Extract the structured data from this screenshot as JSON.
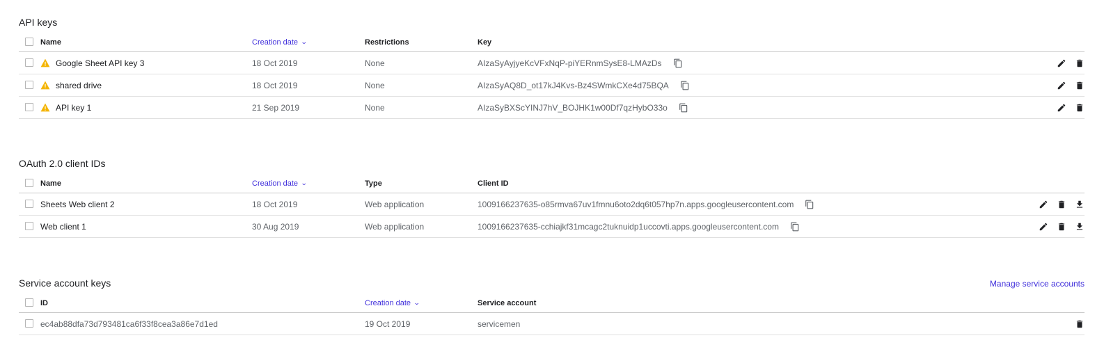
{
  "api_keys": {
    "title": "API keys",
    "columns": {
      "name": "Name",
      "creation_date": "Creation date",
      "restrictions": "Restrictions",
      "key": "Key"
    },
    "rows": [
      {
        "name": "Google Sheet API key 3",
        "date": "18 Oct 2019",
        "restrictions": "None",
        "key": "AIzaSyAyjyeKcVFxNqP-piYERnmSysE8-LMAzDs"
      },
      {
        "name": "shared drive",
        "date": "18 Oct 2019",
        "restrictions": "None",
        "key": "AIzaSyAQ8D_ot17kJ4Kvs-Bz4SWmkCXe4d75BQA"
      },
      {
        "name": "API key 1",
        "date": "21 Sep 2019",
        "restrictions": "None",
        "key": "AIzaSyBXScYINJ7hV_BOJHK1w00Df7qzHybO33o"
      }
    ]
  },
  "oauth": {
    "title": "OAuth 2.0 client IDs",
    "columns": {
      "name": "Name",
      "creation_date": "Creation date",
      "type": "Type",
      "client_id": "Client ID"
    },
    "rows": [
      {
        "name": "Sheets Web client 2",
        "date": "18 Oct 2019",
        "type": "Web application",
        "client_id": "1009166237635-o85rmva67uv1fmnu6oto2dq6t057hp7n.apps.googleusercontent.com"
      },
      {
        "name": "Web client 1",
        "date": "30 Aug 2019",
        "type": "Web application",
        "client_id": "1009166237635-cchiajkf31mcagc2tuknuidp1uccovti.apps.googleusercontent.com"
      }
    ]
  },
  "service_accounts": {
    "title": "Service account keys",
    "manage_link": "Manage service accounts",
    "columns": {
      "id": "ID",
      "creation_date": "Creation date",
      "service_account": "Service account"
    },
    "rows": [
      {
        "id": "ec4ab88dfa73d793481ca6f33f8cea3a86e7d1ed",
        "date": "19 Oct 2019",
        "service_account": "servicemen"
      }
    ]
  },
  "icons": {
    "warning": "warning-icon",
    "copy": "copy-icon",
    "edit": "edit-icon",
    "delete": "delete-icon",
    "download": "download-icon",
    "sort": "chevron-down-icon"
  },
  "colors": {
    "link": "#3f2edb",
    "warning": "#f4b400",
    "text_secondary": "#5f6368"
  }
}
